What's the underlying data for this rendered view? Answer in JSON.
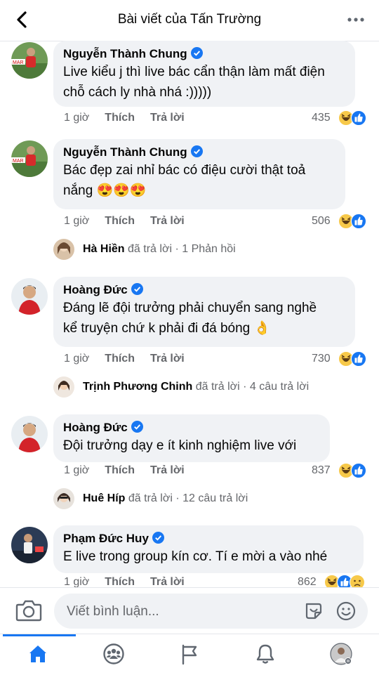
{
  "header": {
    "title": "Bài viết của Tấn Trường"
  },
  "colors": {
    "accent": "#1877f2",
    "secondary_text": "#65676b",
    "bubble": "#f0f2f5"
  },
  "comments": [
    {
      "author": "Nguyễn Thành Chung",
      "line1": "Live kiểu j thì live bác cẩn thận làm mất điện",
      "line2": "chỗ cách ly nhà nhá :)))))",
      "time": "1 giờ",
      "like": "Thích",
      "reply": "Trả lời",
      "count": "435",
      "reactions": [
        "haha-icon",
        "like-icon"
      ]
    },
    {
      "author": "Nguyễn Thành Chung",
      "line1": "Bác đẹp zai nhỉ bác có điệu cười thật toả",
      "line2": "nắng 😍😍😍",
      "time": "1 giờ",
      "like": "Thích",
      "reply": "Trả lời",
      "count": "506",
      "reactions": [
        "haha-icon",
        "like-icon"
      ]
    },
    {
      "author": "Hoàng Đức",
      "line1": "Đáng lẽ đội trưởng phải chuyển sang nghề",
      "line2": "kể truyện chứ k phải đi đá bóng 👌",
      "time": "1 giờ",
      "like": "Thích",
      "reply": "Trả lời",
      "count": "730",
      "reactions": [
        "haha-icon",
        "like-icon"
      ]
    },
    {
      "author": "Hoàng Đức",
      "line1": "Đội trưởng dạy e ít kinh nghiệm live với",
      "time": "1 giờ",
      "like": "Thích",
      "reply": "Trả lời",
      "count": "837",
      "reactions": [
        "haha-icon",
        "like-icon"
      ]
    },
    {
      "author": "Phạm Đức Huy",
      "line1": "E live trong group kín cơ. Tí e mời a vào nhé",
      "time": "1 giờ",
      "like": "Thích",
      "reply": "Trả lời",
      "count": "862",
      "reactions": [
        "haha-icon",
        "like-icon",
        "sad-icon"
      ]
    }
  ],
  "replies": [
    {
      "name": "Hà Hiền",
      "action": "đã trả lời",
      "summary": "· 1 Phản hồi"
    },
    {
      "name": "Trịnh Phương Chinh",
      "action": "đã trả lời",
      "summary": "· 4 câu trả lời"
    },
    {
      "name": "Huê Híp",
      "action": "đã trả lời",
      "summary": "· 12 câu trả lời"
    }
  ],
  "composer": {
    "placeholder": "Viết bình luận..."
  },
  "tabs": [
    "home-icon",
    "groups-icon",
    "pages-flag-icon",
    "notifications-bell-icon",
    "profile-avatar"
  ]
}
